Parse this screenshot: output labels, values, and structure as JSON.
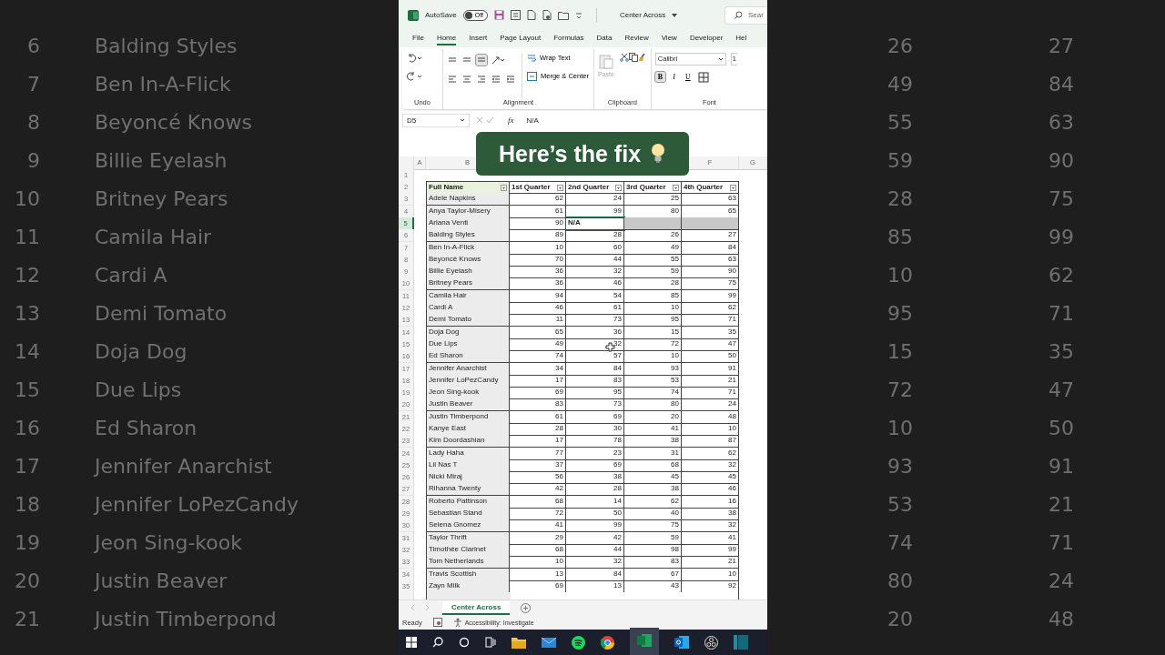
{
  "title_bar": {
    "autosave_label": "AutoSave",
    "autosave": {
      "label": "Off",
      "on": false
    },
    "document": "Center Across",
    "search_placeholder": "Sear"
  },
  "menu_tabs": [
    {
      "label": "File",
      "selected": false
    },
    {
      "label": "Home",
      "selected": true
    },
    {
      "label": "Insert",
      "selected": false
    },
    {
      "label": "Page Layout",
      "selected": false
    },
    {
      "label": "Formulas",
      "selected": false
    },
    {
      "label": "Data",
      "selected": false
    },
    {
      "label": "Review",
      "selected": false
    },
    {
      "label": "View",
      "selected": false
    },
    {
      "label": "Developer",
      "selected": false
    },
    {
      "label": "Hel",
      "selected": false
    }
  ],
  "ribbon": {
    "undo_label": "Undo",
    "wrap_text": "Wrap Text",
    "merge_center": "Merge & Center",
    "alignment_label": "Alignment",
    "paste": "Paste",
    "clipboard_label": "Clipboard",
    "font_name": "Calibri",
    "font_size": "1",
    "bold": {
      "label": "B",
      "on": true
    },
    "italic": "I",
    "underline": "U",
    "font_label": "Font"
  },
  "formula_bar": {
    "name_box": "D5",
    "fx": "fx",
    "value": "N/A"
  },
  "overlay_caption": "Here’s the fix",
  "column_headers_left": [
    "A",
    "B"
  ],
  "column_headers_right": [
    "F",
    "G"
  ],
  "empty_row_number": "1",
  "table": {
    "row_number": "2",
    "headers": [
      "Full Name",
      "1st Quarter",
      "2nd Quarter",
      "3rd Quarter",
      "4th Quarter"
    ],
    "rows": [
      {
        "num": "3",
        "name": "Adele Napkins",
        "values": [
          "62",
          "24",
          "25",
          "63"
        ],
        "selected": false
      },
      {
        "num": "4",
        "name": "Anya Taylor-Misery",
        "values": [
          "61",
          "99",
          "80",
          "65"
        ],
        "selected": false
      },
      {
        "num": "5",
        "name": "Ariana Venti",
        "values": [
          "90",
          "N/A"
        ],
        "selected": true
      },
      {
        "num": "6",
        "name": "Balding Styles",
        "values": [
          "89",
          "28",
          "26",
          "27"
        ],
        "selected": false
      },
      {
        "num": "7",
        "name": "Ben In-A-Flick",
        "values": [
          "10",
          "60",
          "49",
          "84"
        ],
        "selected": false
      },
      {
        "num": "8",
        "name": "Beyoncé Knows",
        "values": [
          "70",
          "44",
          "55",
          "63"
        ],
        "selected": false
      },
      {
        "num": "9",
        "name": "Billie Eyelash",
        "values": [
          "36",
          "32",
          "59",
          "90"
        ],
        "selected": false
      },
      {
        "num": "10",
        "name": "Britney Pears",
        "values": [
          "36",
          "46",
          "28",
          "75"
        ],
        "selected": false
      },
      {
        "num": "11",
        "name": "Camila Hair",
        "values": [
          "94",
          "54",
          "85",
          "99"
        ],
        "selected": false
      },
      {
        "num": "12",
        "name": "Cardi A",
        "values": [
          "46",
          "61",
          "10",
          "62"
        ],
        "selected": false
      },
      {
        "num": "13",
        "name": "Demi Tomato",
        "values": [
          "11",
          "73",
          "95",
          "71"
        ],
        "selected": false
      },
      {
        "num": "14",
        "name": "Doja Dog",
        "values": [
          "65",
          "36",
          "15",
          "35"
        ],
        "selected": false
      },
      {
        "num": "15",
        "name": "Due Lips",
        "values": [
          "49",
          "32",
          "72",
          "47"
        ],
        "selected": false
      },
      {
        "num": "16",
        "name": "Ed Sharon",
        "values": [
          "74",
          "57",
          "10",
          "50"
        ],
        "selected": false
      },
      {
        "num": "17",
        "name": "Jennifer Anarchist",
        "values": [
          "34",
          "84",
          "93",
          "91"
        ],
        "selected": false
      },
      {
        "num": "18",
        "name": "Jennifer LoPezCandy",
        "values": [
          "17",
          "83",
          "53",
          "21"
        ],
        "selected": false
      },
      {
        "num": "19",
        "name": "Jeon Sing-kook",
        "values": [
          "69",
          "95",
          "74",
          "71"
        ],
        "selected": false
      },
      {
        "num": "20",
        "name": "Justin Beaver",
        "values": [
          "83",
          "73",
          "80",
          "24"
        ],
        "selected": false
      },
      {
        "num": "21",
        "name": "Justin Timberpond",
        "values": [
          "61",
          "69",
          "20",
          "48"
        ],
        "selected": false
      },
      {
        "num": "22",
        "name": "Kanye East",
        "values": [
          "28",
          "30",
          "41",
          "10"
        ],
        "selected": false
      },
      {
        "num": "23",
        "name": "Kim Doordashian",
        "values": [
          "17",
          "78",
          "38",
          "87"
        ],
        "selected": false
      },
      {
        "num": "24",
        "name": "Lady Haha",
        "values": [
          "77",
          "23",
          "31",
          "62"
        ],
        "selected": false
      },
      {
        "num": "25",
        "name": "Lil Nas T",
        "values": [
          "37",
          "69",
          "68",
          "32"
        ],
        "selected": false
      },
      {
        "num": "26",
        "name": "Nicki Miraj",
        "values": [
          "56",
          "38",
          "45",
          "45"
        ],
        "selected": false
      },
      {
        "num": "27",
        "name": "Rihanna Twenty",
        "values": [
          "42",
          "28",
          "38",
          "46"
        ],
        "selected": false
      },
      {
        "num": "28",
        "name": "Roberto Pattinson",
        "values": [
          "68",
          "14",
          "62",
          "16"
        ],
        "selected": false
      },
      {
        "num": "29",
        "name": "Sebastian Stand",
        "values": [
          "72",
          "50",
          "40",
          "38"
        ],
        "selected": false
      },
      {
        "num": "30",
        "name": "Selena Gnomez",
        "values": [
          "41",
          "99",
          "75",
          "32"
        ],
        "selected": false
      },
      {
        "num": "31",
        "name": "Taylor Thrift",
        "values": [
          "29",
          "42",
          "59",
          "41"
        ],
        "selected": false
      },
      {
        "num": "32",
        "name": "Timothée Clarinet",
        "values": [
          "68",
          "44",
          "98",
          "99"
        ],
        "selected": false
      },
      {
        "num": "33",
        "name": "Tom Netherlands",
        "values": [
          "10",
          "32",
          "83",
          "21"
        ],
        "selected": false
      },
      {
        "num": "34",
        "name": "Travis Scottish",
        "values": [
          "13",
          "84",
          "67",
          "10"
        ],
        "selected": false
      },
      {
        "num": "35",
        "name": "Zayn Milk",
        "values": [
          "69",
          "13",
          "43",
          "92"
        ],
        "selected": false
      }
    ]
  },
  "sheet_tabs": [
    {
      "label": "Center Across",
      "selected": true
    }
  ],
  "status_bar": {
    "mode": "Ready",
    "accessibility": "Accessibility: Investigate"
  },
  "background_zoom": {
    "rows": [
      {
        "num": "6",
        "name": "Balding Styles",
        "q3": "26",
        "q4": "27"
      },
      {
        "num": "7",
        "name": "Ben In-A-Flick",
        "q3": "49",
        "q4": "84"
      },
      {
        "num": "8",
        "name": "Beyoncé Knows",
        "q3": "55",
        "q4": "63"
      },
      {
        "num": "9",
        "name": "Billie Eyelash",
        "q3": "59",
        "q4": "90"
      },
      {
        "num": "10",
        "name": "Britney Pears",
        "q3": "28",
        "q4": "75"
      },
      {
        "num": "11",
        "name": "Camila Hair",
        "q3": "85",
        "q4": "99"
      },
      {
        "num": "12",
        "name": "Cardi A",
        "q3": "10",
        "q4": "62"
      },
      {
        "num": "13",
        "name": "Demi Tomato",
        "q3": "95",
        "q4": "71"
      },
      {
        "num": "14",
        "name": "Doja Dog",
        "q3": "15",
        "q4": "35"
      },
      {
        "num": "15",
        "name": "Due Lips",
        "q3": "72",
        "q4": "47"
      },
      {
        "num": "16",
        "name": "Ed Sharon",
        "q3": "10",
        "q4": "50"
      },
      {
        "num": "17",
        "name": "Jennifer Anarchist",
        "q3": "93",
        "q4": "91"
      },
      {
        "num": "18",
        "name": "Jennifer LoPezCandy",
        "q3": "53",
        "q4": "21"
      },
      {
        "num": "19",
        "name": "Jeon Sing-kook",
        "q3": "74",
        "q4": "71"
      },
      {
        "num": "20",
        "name": "Justin Beaver",
        "q3": "80",
        "q4": "24"
      },
      {
        "num": "21",
        "name": "Justin Timberpond",
        "q3": "20",
        "q4": "48"
      }
    ]
  }
}
